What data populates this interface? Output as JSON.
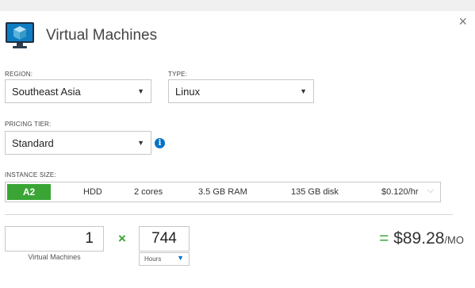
{
  "dialog": {
    "title": "Virtual Machines",
    "close_glyph": "×",
    "icon": "virtual-machine-monitor-icon"
  },
  "region": {
    "label": "REGION:",
    "value": "Southeast Asia"
  },
  "type": {
    "label": "TYPE:",
    "value": "Linux"
  },
  "pricing_tier": {
    "label": "PRICING TIER:",
    "value": "Standard",
    "info_glyph": "i"
  },
  "instance_size": {
    "label": "INSTANCE SIZE:",
    "name": "A2",
    "storage": "HDD",
    "cores": "2 cores",
    "ram": "3.5 GB RAM",
    "disk": "135 GB disk",
    "price": "$0.120/hr"
  },
  "quantity": {
    "value": "1",
    "label": "Virtual Machines",
    "times_glyph": "×"
  },
  "duration": {
    "value": "744",
    "unit": "Hours"
  },
  "total": {
    "equals": "=",
    "amount": "$89.28",
    "per": "/MO"
  },
  "colors": {
    "accent_green": "#3aa535",
    "accent_blue": "#0072c6"
  }
}
